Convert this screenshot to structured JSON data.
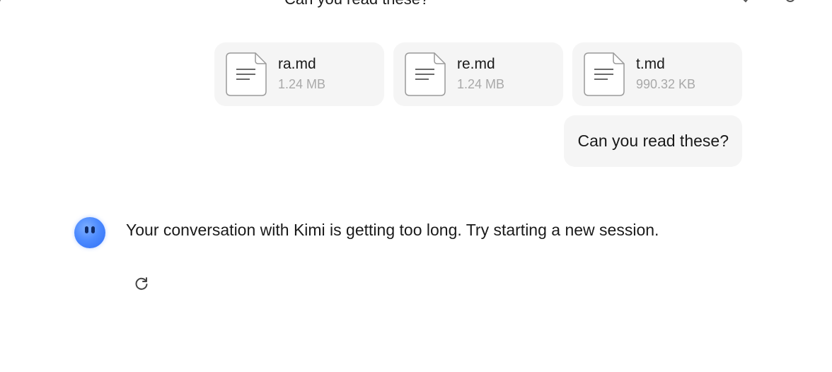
{
  "header": {
    "previous_message": "Can you read these?"
  },
  "files": [
    {
      "name": "ra.md",
      "size": "1.24 MB"
    },
    {
      "name": "re.md",
      "size": "1.24 MB"
    },
    {
      "name": "t.md",
      "size": "990.32 KB"
    }
  ],
  "user_message": "Can you read these?",
  "assistant": {
    "icon": "kimi-avatar-icon",
    "message": "Your conversation with Kimi is getting too long. Try starting a new session.",
    "retry_icon": "refresh-icon"
  },
  "colors": {
    "bubble_bg": "#f5f5f5",
    "secondary_text": "#a9a9a9",
    "avatar_blue": "#4d8bff"
  }
}
